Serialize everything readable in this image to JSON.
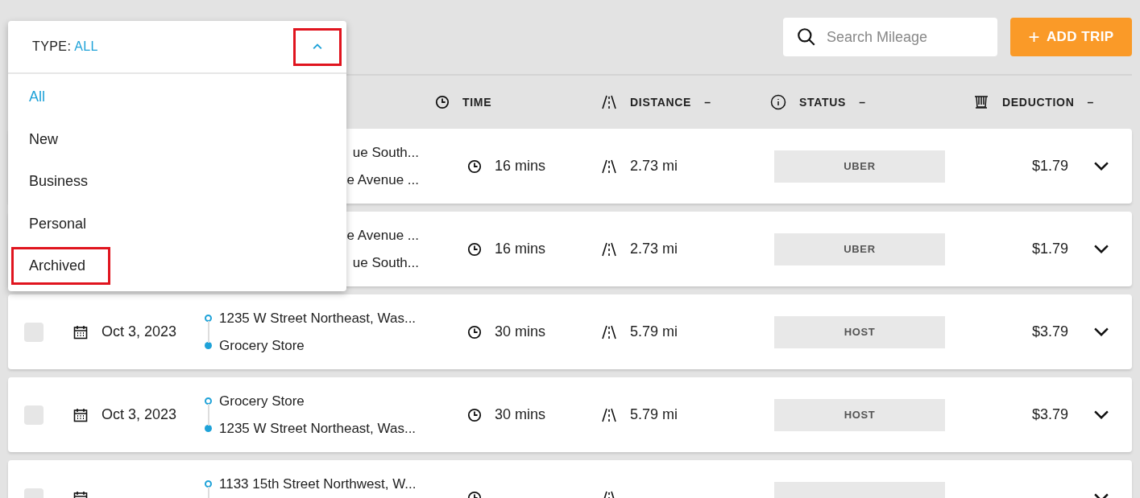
{
  "filter_dropdown": {
    "label": "TYPE:",
    "value": "ALL",
    "expanded": true,
    "toggle_annotated": true,
    "options": [
      {
        "label": "All",
        "selected": true,
        "annotated": false
      },
      {
        "label": "New",
        "selected": false,
        "annotated": false
      },
      {
        "label": "Business",
        "selected": false,
        "annotated": false
      },
      {
        "label": "Personal",
        "selected": false,
        "annotated": false
      },
      {
        "label": "Archived",
        "selected": false,
        "annotated": true
      }
    ]
  },
  "search": {
    "placeholder": "Search Mileage"
  },
  "add_button": {
    "icon": "+",
    "label": "ADD TRIP"
  },
  "columns": [
    {
      "kind": "time",
      "label": "TIME"
    },
    {
      "kind": "distance",
      "label": "DISTANCE",
      "sort_mark": "–"
    },
    {
      "kind": "status",
      "label": "STATUS",
      "sort_mark": "–"
    },
    {
      "kind": "deduction",
      "label": "DEDUCTION",
      "sort_mark": "–"
    }
  ],
  "trips": [
    {
      "from": "ue South...",
      "to": "e Avenue ...",
      "time": "16 mins",
      "distance": "2.73 mi",
      "status": "UBER",
      "deduction": "$1.79"
    },
    {
      "from": "e Avenue ...",
      "to": "ue South...",
      "time": "16 mins",
      "distance": "2.73 mi",
      "status": "UBER",
      "deduction": "$1.79"
    },
    {
      "checked": false,
      "date": "Oct 3, 2023",
      "from": "1235 W Street Northeast, Was...",
      "to": "Grocery Store",
      "time": "30 mins",
      "distance": "5.79 mi",
      "status": "HOST",
      "deduction": "$3.79"
    },
    {
      "checked": false,
      "date": "Oct 3, 2023",
      "from": "Grocery Store",
      "to": "1235 W Street Northeast, Was...",
      "time": "30 mins",
      "distance": "5.79 mi",
      "status": "HOST",
      "deduction": "$3.79"
    },
    {
      "checked": false,
      "from": "1133 15th Street Northwest, W..."
    }
  ]
}
